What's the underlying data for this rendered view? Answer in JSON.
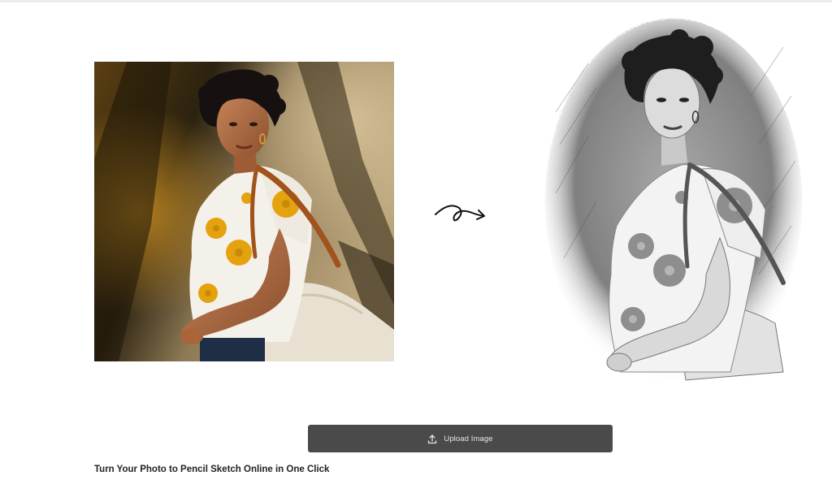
{
  "upload": {
    "label": "Upload Image",
    "icon": "upload-icon"
  },
  "headline": "Turn Your Photo to Pencil Sketch Online in One Click",
  "images": {
    "original_icon": "photo",
    "arrow_icon": "curly-arrow-right-icon",
    "sketch_icon": "pencil-sketch-photo"
  },
  "colors": {
    "button_bg": "#4a4a4a",
    "button_text": "#e8e8e8",
    "headline": "#222222",
    "flower_yellow": "#e5a20f",
    "bag_strap": "#a0531c"
  }
}
